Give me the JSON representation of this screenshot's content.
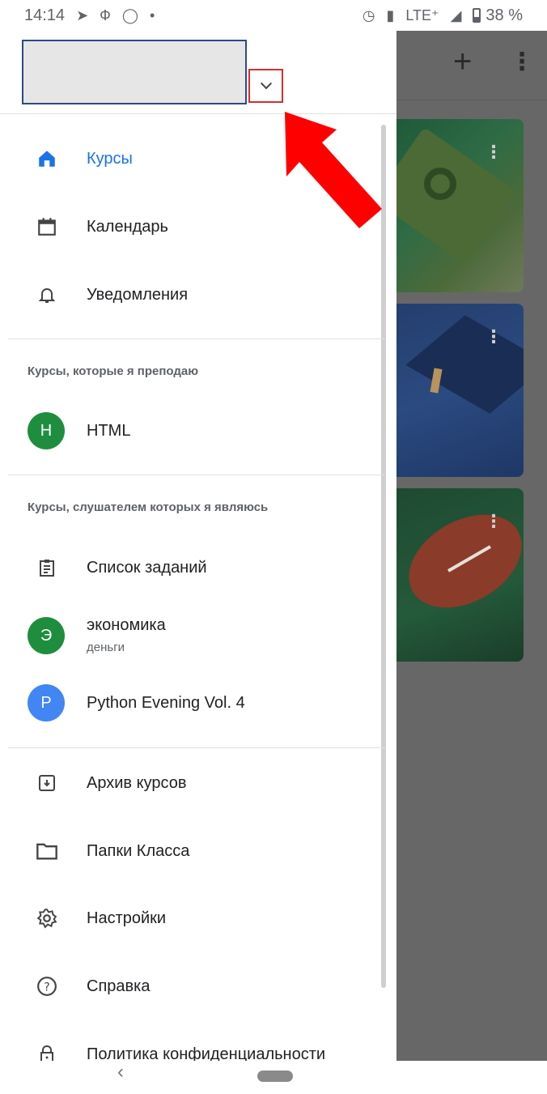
{
  "status_bar": {
    "time": "14:14",
    "network": "LTE⁺",
    "battery": "38 %"
  },
  "drawer": {
    "nav_items": [
      {
        "label": "Курсы",
        "icon": "home-icon",
        "active": true
      },
      {
        "label": "Календарь",
        "icon": "calendar-icon",
        "active": false
      },
      {
        "label": "Уведомления",
        "icon": "bell-icon",
        "active": false
      }
    ],
    "teaching": {
      "title": "Курсы, которые я преподаю",
      "courses": [
        {
          "avatar": "H",
          "name": "HTML",
          "color": "#1e8e3e"
        }
      ]
    },
    "enrolled": {
      "title": "Курсы, слушателем которых я являюсь",
      "todo_label": "Список заданий",
      "courses": [
        {
          "avatar": "Э",
          "name": "экономика",
          "subtitle": "деньги",
          "color": "#1e8e3e"
        },
        {
          "avatar": "P",
          "name": "Python Evening Vol. 4",
          "subtitle": "",
          "color": "#4285f4"
        }
      ]
    },
    "footer_items": [
      {
        "label": "Архив курсов",
        "icon": "archive-icon"
      },
      {
        "label": "Папки Класса",
        "icon": "folder-icon"
      },
      {
        "label": "Настройки",
        "icon": "gear-icon"
      },
      {
        "label": "Справка",
        "icon": "help-icon"
      },
      {
        "label": "Политика конфиденциальности",
        "icon": "lock-icon"
      }
    ]
  },
  "colors": {
    "accent": "#1a73e8",
    "annotation": "#ff0000"
  }
}
